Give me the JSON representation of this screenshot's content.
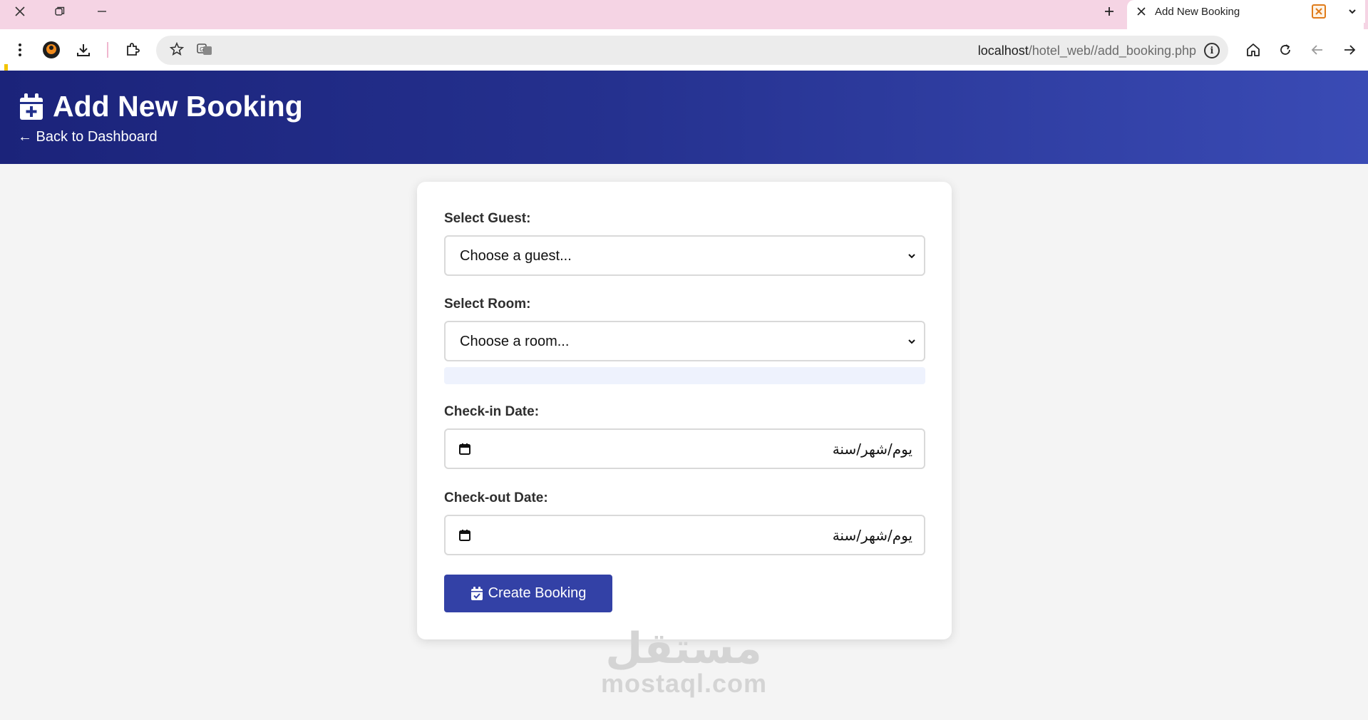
{
  "browser": {
    "tab": {
      "title": "Add New Booking"
    },
    "address_bar": {
      "host": "localhost",
      "path": "/hotel_web//add_booking.php"
    }
  },
  "header": {
    "title": "Add New Booking",
    "back_link": "← Back to Dashboard"
  },
  "form": {
    "guest": {
      "label": "Select Guest:",
      "value": "Choose a guest..."
    },
    "room": {
      "label": "Select Room:",
      "value": "Choose a room..."
    },
    "checkin": {
      "label": "Check-in Date:",
      "value": "يوم/شهر/سنة"
    },
    "checkout": {
      "label": "Check-out Date:",
      "value": "يوم/شهر/سنة"
    },
    "submit_label": "Create Booking"
  },
  "watermark": {
    "arabic": "مستقل",
    "latin": "mostaql.com"
  },
  "colors": {
    "header_start": "#1b237a",
    "header_end": "#3a4bb5",
    "button": "#3341a6",
    "tab_strip": "#f5d4e4"
  }
}
